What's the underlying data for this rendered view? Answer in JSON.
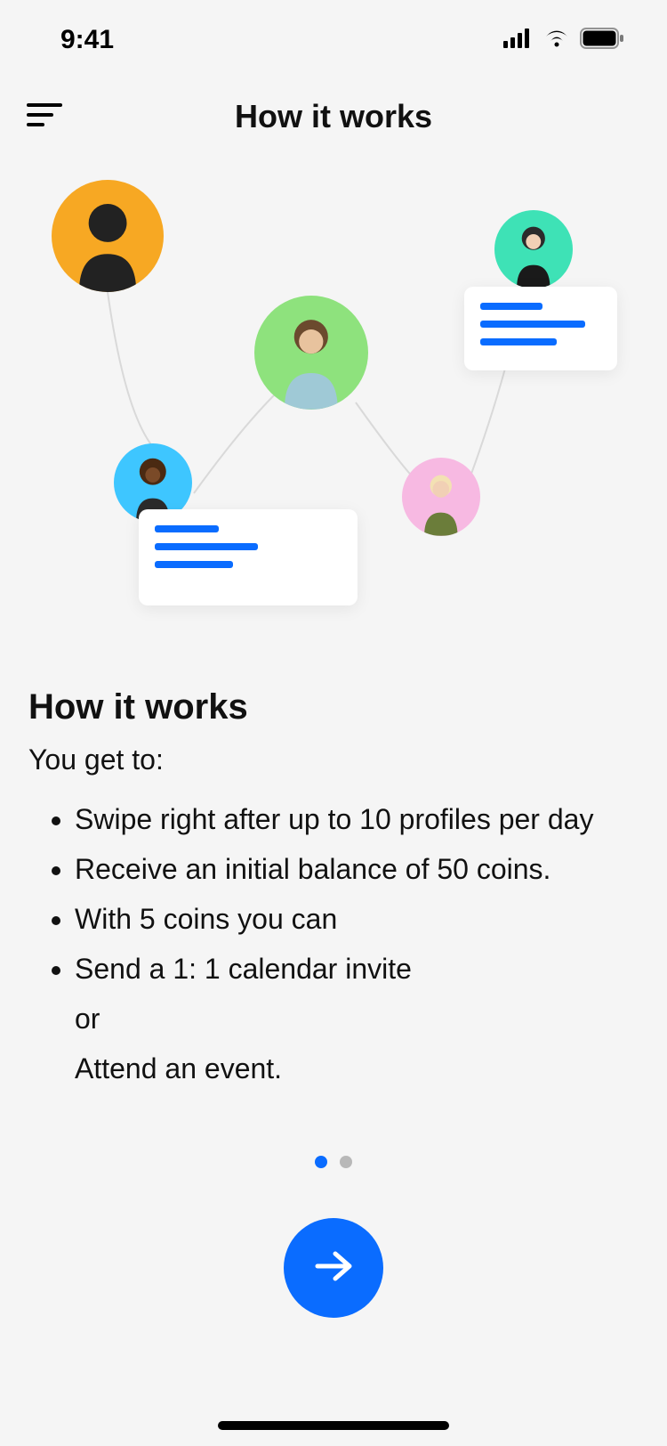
{
  "status": {
    "time": "9:41"
  },
  "header": {
    "title": "How it works"
  },
  "content": {
    "heading": "How it works",
    "intro": "You get to:",
    "bullets": [
      "Swipe right after up to 10 profiles per day",
      "Receive an initial balance of 50 coins.",
      "With 5 coins you can",
      "Send a 1: 1 calendar invite"
    ],
    "bullet4_sub1": "or",
    "bullet4_sub2": "Attend an event."
  },
  "pager": {
    "current": 1,
    "total": 2
  },
  "colors": {
    "accent": "#0a6cff",
    "avatar_bg": [
      "#f7a823",
      "#8ee27d",
      "#3ec6ff",
      "#f7b9e2",
      "#3ee2b6"
    ]
  },
  "icons": {
    "menu": "menu-icon",
    "next": "arrow-right-icon",
    "signal": "cell-signal-icon",
    "wifi": "wifi-icon",
    "battery": "battery-icon"
  }
}
